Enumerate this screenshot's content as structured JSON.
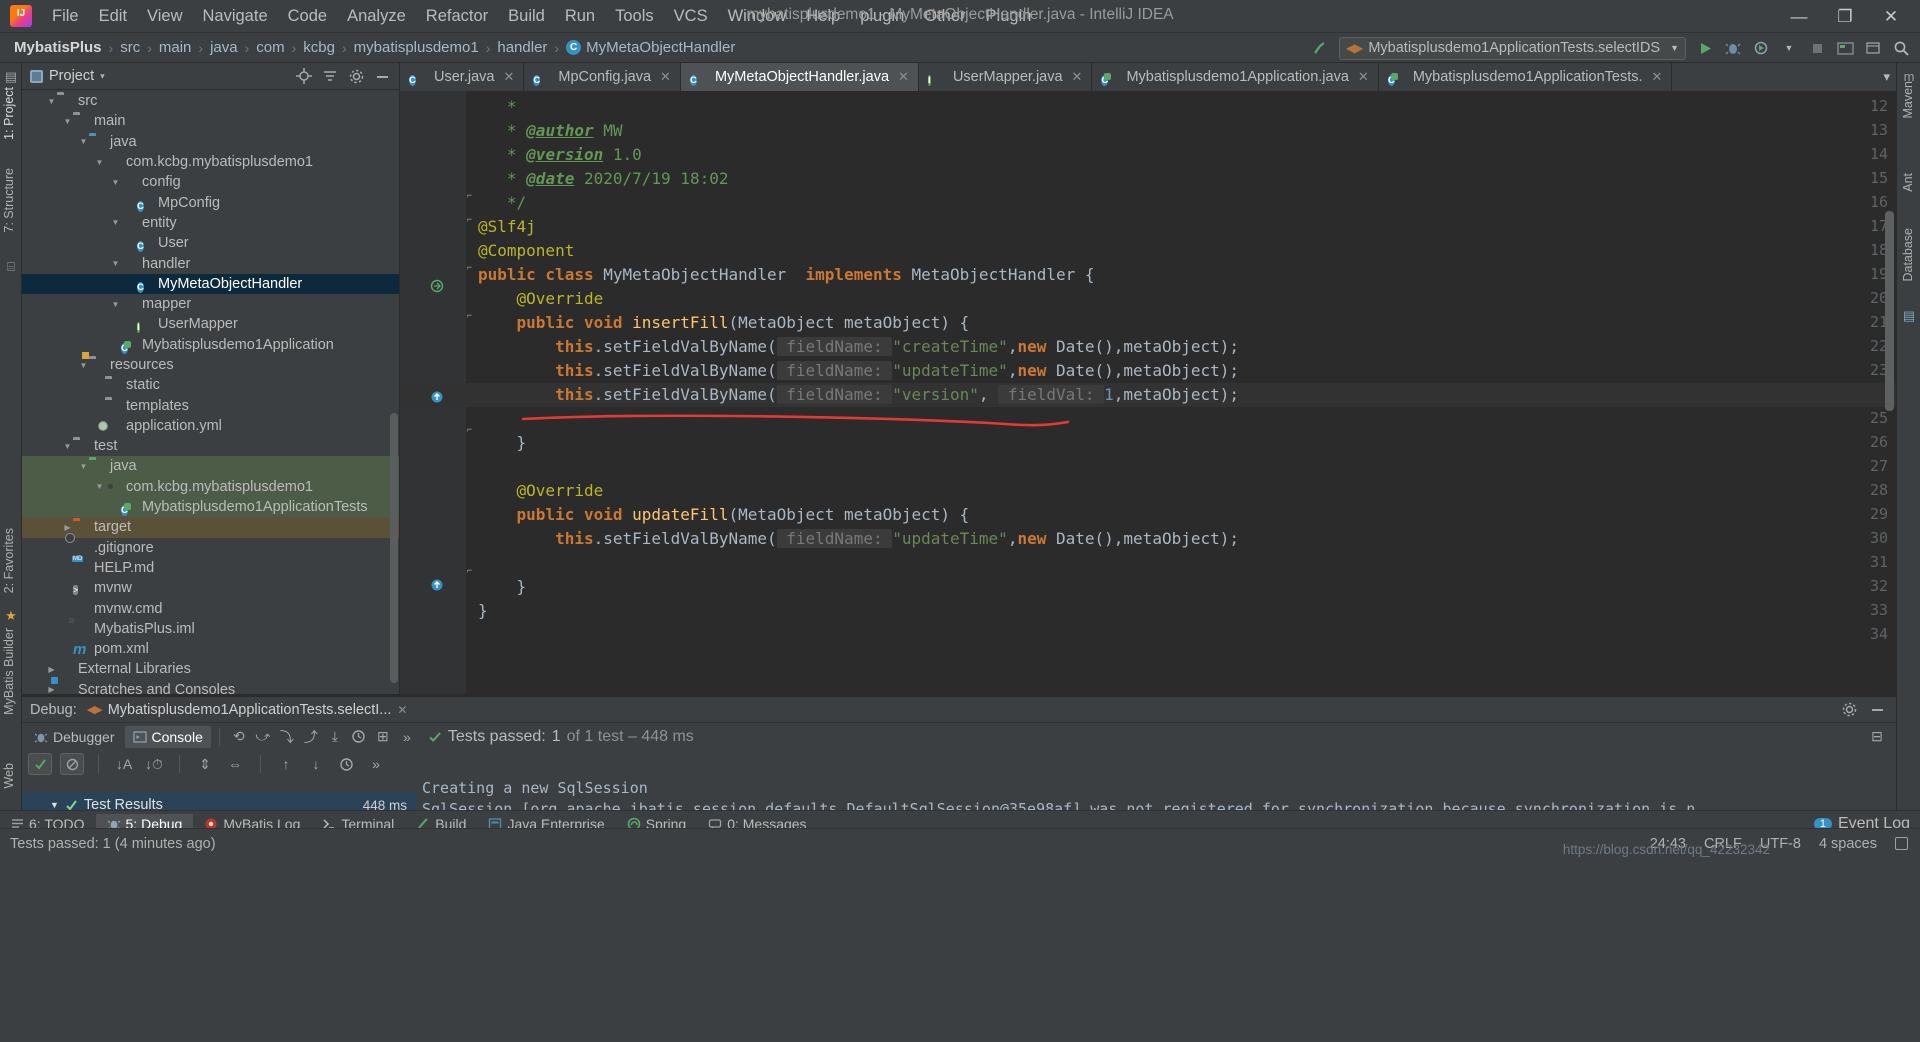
{
  "window": {
    "title": "mybatisplusdemo1 - MyMetaObjectHandler.java - IntelliJ IDEA",
    "minimize": "—",
    "maximize": "❐",
    "close": "✕"
  },
  "menu": {
    "items": [
      "File",
      "Edit",
      "View",
      "Navigate",
      "Code",
      "Analyze",
      "Refactor",
      "Build",
      "Run",
      "Tools",
      "VCS",
      "Window",
      "Help",
      "plugin",
      "Other",
      "Plugin"
    ]
  },
  "breadcrumb": {
    "items": [
      "MybatisPlus",
      "src",
      "main",
      "java",
      "com",
      "kcbg",
      "mybatisplusdemo1",
      "handler",
      "MyMetaObjectHandler"
    ],
    "separator": "›",
    "class_badge": "C"
  },
  "toolbar": {
    "run_config": "Mybatisplusdemo1ApplicationTests.selectIDS",
    "run_label": "▶",
    "debug_label": "🐞",
    "search_label": "🔍"
  },
  "project_panel": {
    "title": "Project",
    "caret": "▾",
    "tree": [
      {
        "label": "src",
        "indent": 1,
        "arrow": "▼",
        "icon": "folder",
        "state": "normal"
      },
      {
        "label": "main",
        "indent": 2,
        "arrow": "▼",
        "icon": "folder",
        "state": "normal"
      },
      {
        "label": "java",
        "indent": 3,
        "arrow": "▼",
        "icon": "folder-blue",
        "state": "normal"
      },
      {
        "label": "com.kcbg.mybatisplusdemo1",
        "indent": 4,
        "arrow": "▼",
        "icon": "package",
        "state": "normal"
      },
      {
        "label": "config",
        "indent": 5,
        "arrow": "▼",
        "icon": "package",
        "state": "normal"
      },
      {
        "label": "MpConfig",
        "indent": 6,
        "arrow": "",
        "icon": "class",
        "state": "normal"
      },
      {
        "label": "entity",
        "indent": 5,
        "arrow": "▼",
        "icon": "package",
        "state": "normal"
      },
      {
        "label": "User",
        "indent": 6,
        "arrow": "",
        "icon": "class",
        "state": "normal"
      },
      {
        "label": "handler",
        "indent": 5,
        "arrow": "▼",
        "icon": "package",
        "state": "normal"
      },
      {
        "label": "MyMetaObjectHandler",
        "indent": 6,
        "arrow": "",
        "icon": "class",
        "state": "selected"
      },
      {
        "label": "mapper",
        "indent": 5,
        "arrow": "▼",
        "icon": "package",
        "state": "normal"
      },
      {
        "label": "UserMapper",
        "indent": 6,
        "arrow": "",
        "icon": "interface",
        "state": "normal"
      },
      {
        "label": "Mybatisplusdemo1Application",
        "indent": 5,
        "arrow": "",
        "icon": "spring-class",
        "state": "normal"
      },
      {
        "label": "resources",
        "indent": 3,
        "arrow": "▼",
        "icon": "folder-res",
        "state": "normal"
      },
      {
        "label": "static",
        "indent": 4,
        "arrow": "",
        "icon": "folder",
        "state": "normal"
      },
      {
        "label": "templates",
        "indent": 4,
        "arrow": "",
        "icon": "folder",
        "state": "normal"
      },
      {
        "label": "application.yml",
        "indent": 4,
        "arrow": "",
        "icon": "yml",
        "state": "normal"
      },
      {
        "label": "test",
        "indent": 2,
        "arrow": "▼",
        "icon": "folder",
        "state": "normal"
      },
      {
        "label": "java",
        "indent": 3,
        "arrow": "▼",
        "icon": "folder-green",
        "state": "testsrc"
      },
      {
        "label": "com.kcbg.mybatisplusdemo1",
        "indent": 4,
        "arrow": "▼",
        "icon": "package",
        "state": "testsrc"
      },
      {
        "label": "Mybatisplusdemo1ApplicationTests",
        "indent": 5,
        "arrow": "",
        "icon": "spring-class",
        "state": "testsrc"
      },
      {
        "label": "target",
        "indent": 2,
        "arrow": "▶",
        "icon": "folder-orange",
        "state": "target"
      },
      {
        "label": ".gitignore",
        "indent": 2,
        "arrow": "",
        "icon": "gitignore",
        "state": "normal"
      },
      {
        "label": "HELP.md",
        "indent": 2,
        "arrow": "",
        "icon": "markdown",
        "state": "normal"
      },
      {
        "label": "mvnw",
        "indent": 2,
        "arrow": "",
        "icon": "shell",
        "state": "normal"
      },
      {
        "label": "mvnw.cmd",
        "indent": 2,
        "arrow": "",
        "icon": "file",
        "state": "normal"
      },
      {
        "label": "MybatisPlus.iml",
        "indent": 2,
        "arrow": "",
        "icon": "iml",
        "state": "normal"
      },
      {
        "label": "pom.xml",
        "indent": 2,
        "arrow": "",
        "icon": "maven",
        "state": "normal"
      },
      {
        "label": "External Libraries",
        "indent": 1,
        "arrow": "▶",
        "icon": "library",
        "state": "normal"
      },
      {
        "label": "Scratches and Consoles",
        "indent": 1,
        "arrow": "▶",
        "icon": "scratch",
        "state": "normal"
      }
    ]
  },
  "left_strip": {
    "tabs": [
      "1: Project",
      "7: Structure",
      "2: Favorites",
      "MyBatis Builder",
      "Web"
    ]
  },
  "right_strip": {
    "tabs": [
      "Maven",
      "Ant",
      "Database"
    ]
  },
  "editor_tabs": [
    {
      "label": "User.java",
      "icon": "class",
      "active": false
    },
    {
      "label": "MpConfig.java",
      "icon": "class",
      "active": false
    },
    {
      "label": "MyMetaObjectHandler.java",
      "icon": "class",
      "active": true
    },
    {
      "label": "UserMapper.java",
      "icon": "interface",
      "active": false
    },
    {
      "label": "Mybatisplusdemo1Application.java",
      "icon": "spring-class",
      "active": false
    },
    {
      "label": "Mybatisplusdemo1ApplicationTests.",
      "icon": "spring-class",
      "active": false
    }
  ],
  "editor": {
    "first_line_number": 12,
    "last_line_number": 34,
    "lines": [
      {
        "n": 12,
        "segments": [
          {
            "t": "   *",
            "c": "jd"
          }
        ]
      },
      {
        "n": 13,
        "segments": [
          {
            "t": "   * ",
            "c": "jd"
          },
          {
            "t": "@author",
            "c": "jdtag"
          },
          {
            "t": " MW",
            "c": "jd"
          }
        ]
      },
      {
        "n": 14,
        "segments": [
          {
            "t": "   * ",
            "c": "jd"
          },
          {
            "t": "@version",
            "c": "jdtag"
          },
          {
            "t": " 1.0",
            "c": "jd"
          }
        ]
      },
      {
        "n": 15,
        "segments": [
          {
            "t": "   * ",
            "c": "jd"
          },
          {
            "t": "@date",
            "c": "jdtag"
          },
          {
            "t": " 2020/7/19 18:02",
            "c": "jd"
          }
        ]
      },
      {
        "n": 16,
        "segments": [
          {
            "t": "   */",
            "c": "jd"
          }
        ]
      },
      {
        "n": 17,
        "segments": [
          {
            "t": "@Slf4j",
            "c": "ann"
          }
        ]
      },
      {
        "n": 18,
        "segments": [
          {
            "t": "@Component",
            "c": "ann"
          }
        ]
      },
      {
        "n": 19,
        "segments": [
          {
            "t": "public class ",
            "c": "kw"
          },
          {
            "t": "MyMetaObjectHandler",
            "c": "typ"
          },
          {
            "t": "  ",
            "c": "typ"
          },
          {
            "t": "implements ",
            "c": "kw"
          },
          {
            "t": "MetaObjectHandler {",
            "c": "typ"
          }
        ]
      },
      {
        "n": 20,
        "segments": [
          {
            "t": "    ",
            "c": "typ"
          },
          {
            "t": "@Override",
            "c": "ann"
          }
        ]
      },
      {
        "n": 21,
        "segments": [
          {
            "t": "    ",
            "c": "typ"
          },
          {
            "t": "public void ",
            "c": "kw"
          },
          {
            "t": "insertFill",
            "c": "mth"
          },
          {
            "t": "(MetaObject metaObject) {",
            "c": "typ"
          }
        ]
      },
      {
        "n": 22,
        "segments": [
          {
            "t": "        ",
            "c": "typ"
          },
          {
            "t": "this",
            "c": "kw"
          },
          {
            "t": ".setFieldValByName(",
            "c": "typ"
          },
          {
            "t": " fieldName: ",
            "c": "hint"
          },
          {
            "t": "\"createTime\"",
            "c": "str"
          },
          {
            "t": ",",
            "c": "typ"
          },
          {
            "t": "new ",
            "c": "kw"
          },
          {
            "t": "Date(),metaObject);",
            "c": "typ"
          }
        ]
      },
      {
        "n": 23,
        "segments": [
          {
            "t": "        ",
            "c": "typ"
          },
          {
            "t": "this",
            "c": "kw"
          },
          {
            "t": ".setFieldValByName(",
            "c": "typ"
          },
          {
            "t": " fieldName: ",
            "c": "hint"
          },
          {
            "t": "\"updateTime\"",
            "c": "str"
          },
          {
            "t": ",",
            "c": "typ"
          },
          {
            "t": "new ",
            "c": "kw"
          },
          {
            "t": "Date(),metaObject);",
            "c": "typ"
          }
        ]
      },
      {
        "n": 24,
        "segments": [
          {
            "t": "        ",
            "c": "typ"
          },
          {
            "t": "this",
            "c": "kw"
          },
          {
            "t": ".setFieldValByName(",
            "c": "typ"
          },
          {
            "t": " fieldName: ",
            "c": "hint"
          },
          {
            "t": "\"version\"",
            "c": "str"
          },
          {
            "t": ", ",
            "c": "typ"
          },
          {
            "t": " fieldVal: ",
            "c": "hint"
          },
          {
            "t": "1",
            "c": "num"
          },
          {
            "t": ",metaObject);",
            "c": "typ"
          }
        ]
      },
      {
        "n": 25,
        "segments": []
      },
      {
        "n": 26,
        "segments": [
          {
            "t": "    }",
            "c": "typ"
          }
        ]
      },
      {
        "n": 27,
        "segments": []
      },
      {
        "n": 28,
        "segments": [
          {
            "t": "    ",
            "c": "typ"
          },
          {
            "t": "@Override",
            "c": "ann"
          }
        ]
      },
      {
        "n": 29,
        "segments": [
          {
            "t": "    ",
            "c": "typ"
          },
          {
            "t": "public void ",
            "c": "kw"
          },
          {
            "t": "updateFill",
            "c": "mth"
          },
          {
            "t": "(MetaObject metaObject) {",
            "c": "typ"
          }
        ]
      },
      {
        "n": 30,
        "segments": [
          {
            "t": "        ",
            "c": "typ"
          },
          {
            "t": "this",
            "c": "kw"
          },
          {
            "t": ".setFieldValByName(",
            "c": "typ"
          },
          {
            "t": " fieldName: ",
            "c": "hint"
          },
          {
            "t": "\"updateTime\"",
            "c": "str"
          },
          {
            "t": ",",
            "c": "typ"
          },
          {
            "t": "new ",
            "c": "kw"
          },
          {
            "t": "Date(),metaObject);",
            "c": "typ"
          }
        ]
      },
      {
        "n": 31,
        "segments": []
      },
      {
        "n": 32,
        "segments": [
          {
            "t": "    }",
            "c": "typ"
          }
        ]
      },
      {
        "n": 33,
        "segments": [
          {
            "t": "}",
            "c": "typ"
          }
        ]
      },
      {
        "n": 34,
        "segments": []
      }
    ],
    "highlight_line": 24,
    "annotation": "red-underline-mark"
  },
  "debug_panel": {
    "title": "Debug:",
    "session": "Mybatisplusdemo1ApplicationTests.selectI...",
    "session_close": "✕",
    "tabs": [
      {
        "label": "Debugger",
        "icon": "debugger-icon",
        "active": false
      },
      {
        "label": "Console",
        "icon": "console-icon",
        "active": true
      }
    ],
    "status": {
      "prefix": "Tests passed:",
      "count": "1",
      "suffix": "of 1 test – 448 ms"
    },
    "results": {
      "label": "Test Results",
      "time": "448 ms",
      "caret": "▼"
    },
    "console_lines": [
      "Creating a new SqlSession",
      "SqlSession [org.apache.ibatis.session.defaults.DefaultSqlSession@35e98af] was not registered for synchronization because synchronization is n"
    ]
  },
  "bottom_bar": {
    "items": [
      {
        "label": "6: TODO",
        "icon": "todo-icon",
        "active": false
      },
      {
        "label": "5: Debug",
        "icon": "debug-icon",
        "active": true
      },
      {
        "label": "MyBatis Log",
        "icon": "mybatis-icon",
        "active": false
      },
      {
        "label": "Terminal",
        "icon": "terminal-icon",
        "active": false
      },
      {
        "label": "Build",
        "icon": "build-icon",
        "active": false
      },
      {
        "label": "Java Enterprise",
        "icon": "java-ee-icon",
        "active": false
      },
      {
        "label": "Spring",
        "icon": "spring-icon",
        "active": false
      },
      {
        "label": "0: Messages",
        "icon": "messages-icon",
        "active": false
      }
    ],
    "event_log": "Event Log",
    "event_count": "1"
  },
  "status_bar": {
    "message": "Tests passed: 1 (4 minutes ago)",
    "caret_position": "24:43",
    "line_separator": "CRLF",
    "encoding": "UTF-8",
    "indent": "4 spaces",
    "lock": "lock-icon"
  },
  "watermark": "https://blog.csdn.net/qq_42232342",
  "colors": {
    "accent_blue": "#3592c4",
    "green": "#59a869",
    "orange": "#cc5f26",
    "selection": "#0d293e",
    "test_src": "#4d5c47",
    "target_dir": "#5b5139",
    "editor_bg": "#2b2b2b",
    "panel_bg": "#3c3f41",
    "red_mark": "#e53935"
  }
}
